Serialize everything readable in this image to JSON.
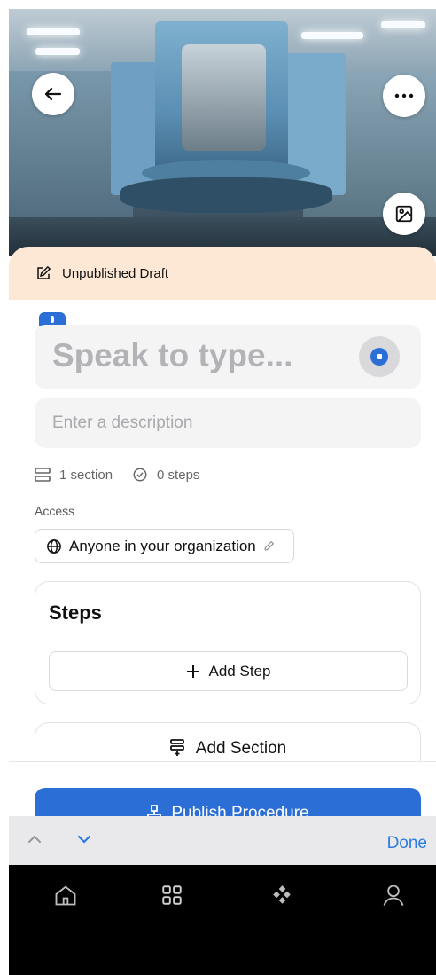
{
  "header": {
    "back_icon": "arrow-left-icon",
    "more_icon": "ellipsis-icon",
    "image_icon": "image-icon"
  },
  "draft_banner": {
    "label": "Unpublished Draft",
    "icon": "edit-icon"
  },
  "title_field": {
    "placeholder": "Speak to type..."
  },
  "description_field": {
    "placeholder": "Enter a description"
  },
  "meta": {
    "sections": "1 section",
    "steps": "0 steps"
  },
  "access": {
    "label": "Access",
    "value": "Anyone in your organization"
  },
  "steps_card": {
    "heading": "Steps",
    "add_step": "Add Step"
  },
  "add_section": "Add Section",
  "publish": "Publish Procedure",
  "keyboard_bar": {
    "done": "Done"
  },
  "tabbar": {
    "items": [
      "home-icon",
      "grid-icon",
      "apps-icon",
      "profile-icon"
    ]
  },
  "colors": {
    "accent": "#2b6fd6",
    "banner": "#fde8d6",
    "done": "#2b7be0"
  }
}
